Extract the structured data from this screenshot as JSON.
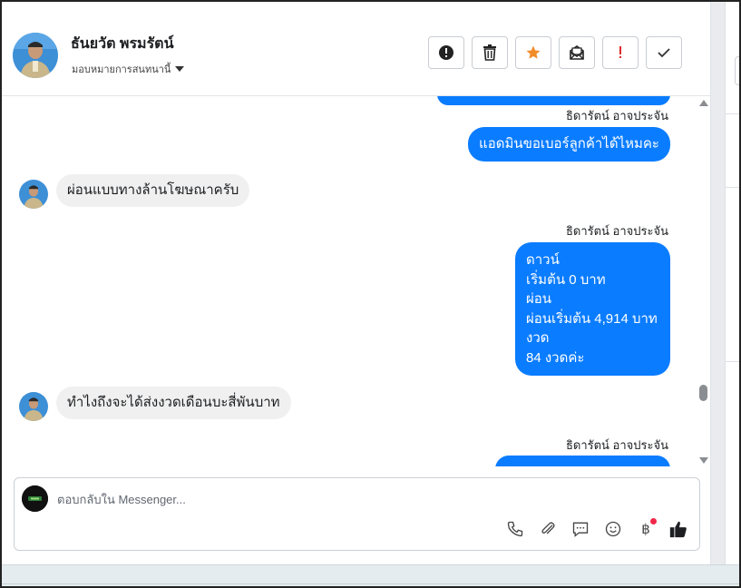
{
  "contact": {
    "name": "ธันยวัต พรมรัตน์",
    "assign_label": "มอบหมายการสนทนานี้"
  },
  "actions": [
    {
      "name": "spam-button",
      "icon": "alert-circle-icon"
    },
    {
      "name": "delete-button",
      "icon": "trash-icon"
    },
    {
      "name": "star-button",
      "icon": "star-icon",
      "color": "#f28c28"
    },
    {
      "name": "mark-unread-button",
      "icon": "envelope-icon"
    },
    {
      "name": "follow-up-button",
      "icon": "exclamation-icon",
      "color": "#e02b2b"
    },
    {
      "name": "done-button",
      "icon": "check-icon"
    }
  ],
  "messages": {
    "sender_name": "ธิดารัตน์ อาจประจัน",
    "sender_name_2": "ธิดารัตน์ อาจประจัน",
    "sender_name_3": "ธิดารัตน์ อาจประจัน",
    "out_1": "แอดมินขอเบอร์ลูกค้าได้ไหมคะ",
    "in_1": "ผ่อนแบบทางล้านโฆษณาครับ",
    "out_2_lines": [
      "ดาวน์",
      "เริ่มต้น 0 บาท",
      "ผ่อน",
      "ผ่อนเริ่มต้น 4,914 บาท",
      "งวด",
      "84 งวดค่ะ"
    ],
    "in_2": "ทำไงถึงจะได้ส่งงวดเดือนบะสี่พันบาท"
  },
  "composer": {
    "placeholder": "ตอบกลับใน Messenger..."
  },
  "colors": {
    "accent": "#0a7cff",
    "star": "#f28c28",
    "followup": "#e02b2b",
    "notification_dot": "#f0284a"
  }
}
